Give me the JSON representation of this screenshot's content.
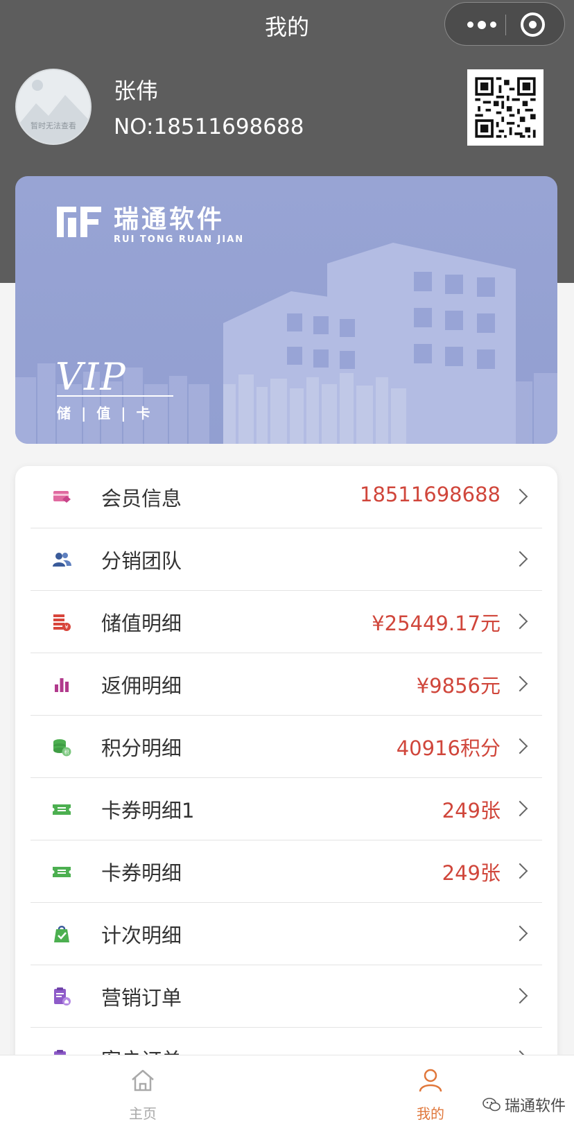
{
  "nav": {
    "title": "我的"
  },
  "profile": {
    "avatar_note": "暂时无法查看",
    "name": "张伟",
    "member_no": "NO:18511698688"
  },
  "card": {
    "brand_cn": "瑞通软件",
    "brand_en": "RUI TONG RUAN JIAN",
    "vip": "VIP",
    "subtitle": "储 | 值 | 卡",
    "color": "#939fd1"
  },
  "menu": {
    "items": [
      {
        "label": "会员信息",
        "value": "18511698688",
        "icon": "member-card-icon",
        "color": "#e06aa0"
      },
      {
        "label": "分销团队",
        "value": "",
        "icon": "team-icon",
        "color": "#3a5b9a"
      },
      {
        "label": "储值明细",
        "value": "¥25449.17元",
        "icon": "stored-value-icon",
        "color": "#d8453b"
      },
      {
        "label": "返佣明细",
        "value": "¥9856元",
        "icon": "commission-chart-icon",
        "color": "#b13a8c"
      },
      {
        "label": "积分明细",
        "value": "40916积分",
        "icon": "points-coin-icon",
        "color": "#4caf50"
      },
      {
        "label": "卡券明细1",
        "value": "249张",
        "icon": "coupon-icon",
        "color": "#4caf50"
      },
      {
        "label": "卡券明细",
        "value": "249张",
        "icon": "coupon-icon",
        "color": "#4caf50"
      },
      {
        "label": "计次明细",
        "value": "",
        "icon": "count-bag-icon",
        "color": "#4caf50"
      },
      {
        "label": "营销订单",
        "value": "",
        "icon": "marketing-order-icon",
        "color": "#8e5bc9"
      },
      {
        "label": "客户订单",
        "value": "",
        "icon": "customer-order-icon",
        "color": "#8e5bc9"
      }
    ]
  },
  "tabbar": {
    "home_label": "主页",
    "me_label": "我的",
    "active_color": "#e0773b",
    "inactive_color": "#a9a9a9"
  },
  "watermark": {
    "text": "瑞通软件"
  }
}
